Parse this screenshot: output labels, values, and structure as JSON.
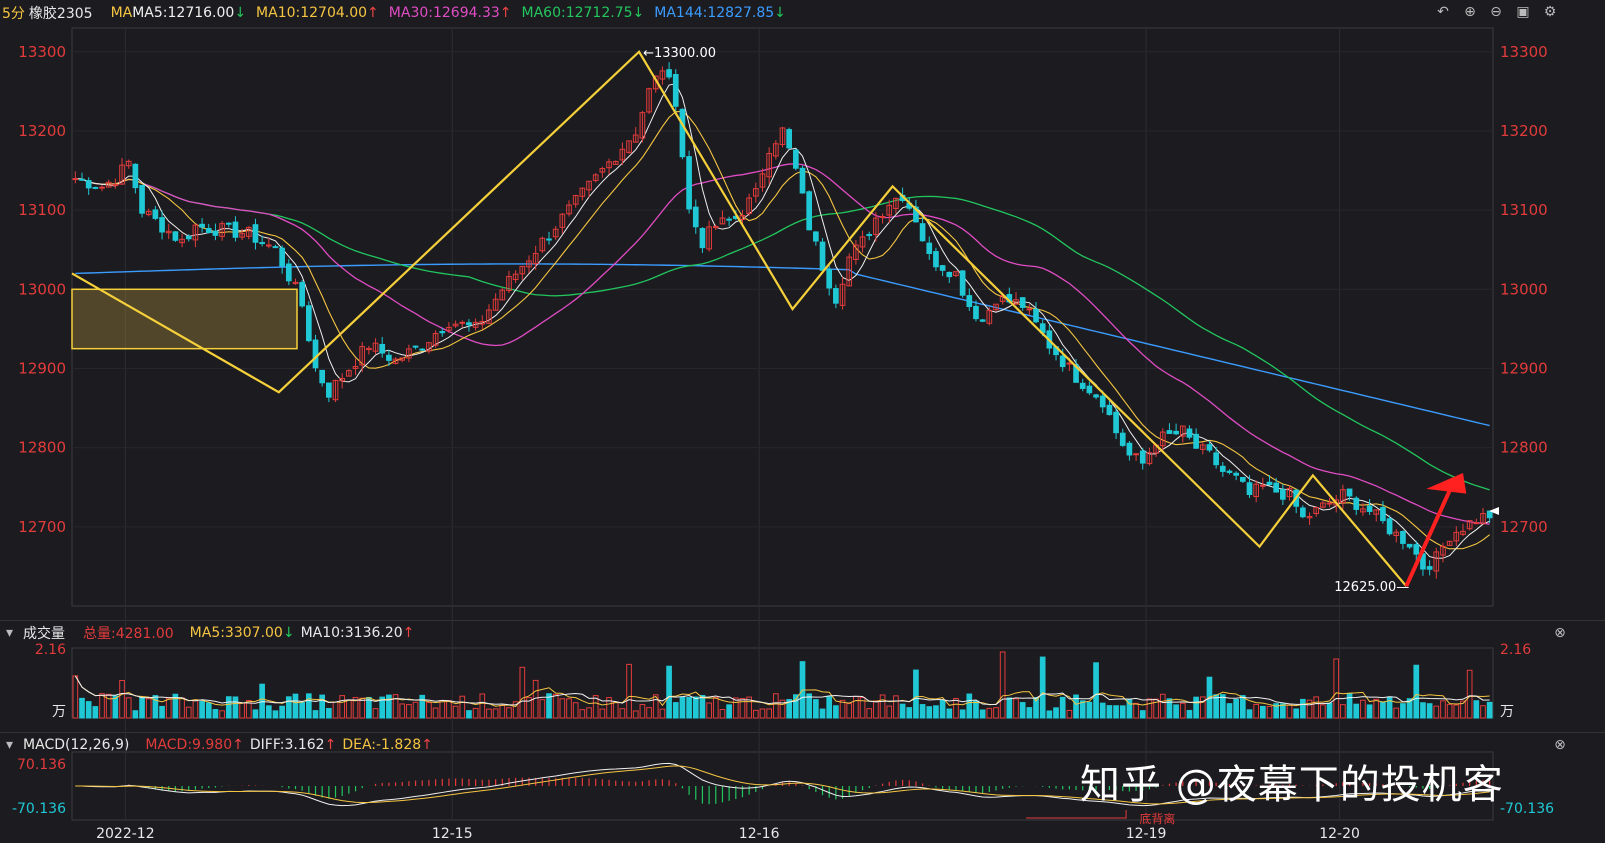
{
  "header": {
    "period": "5分",
    "symbol": "橡胶2305",
    "ma_label": "MA",
    "ma_items": [
      {
        "text": "MA5:12716.00",
        "arrow": "↓",
        "color": "#f0f0f0",
        "arrow_color": "#22c55e"
      },
      {
        "text": "MA10:12704.00",
        "arrow": "↑",
        "color": "#f5c542",
        "arrow_color": "#ef4444"
      },
      {
        "text": "MA30:12694.33",
        "arrow": "↑",
        "color": "#e04cc4",
        "arrow_color": "#ef4444"
      },
      {
        "text": "MA60:12712.75",
        "arrow": "↓",
        "color": "#22c55e",
        "arrow_color": "#22c55e"
      },
      {
        "text": "MA144:12827.85",
        "arrow": "↓",
        "color": "#3b9cff",
        "arrow_color": "#22c55e"
      }
    ]
  },
  "volume_header": {
    "title": "成交量",
    "total": "总量:4281.00",
    "ma5": "MA5:3307.00",
    "ma5_arrow": "↓",
    "ma10": "MA10:3136.20",
    "ma10_arrow": "↑"
  },
  "macd_header": {
    "title": "MACD(12,26,9)",
    "macd": "MACD:9.980",
    "macd_arrow": "↑",
    "diff": "DIFF:3.162",
    "diff_arrow": "↑",
    "dea": "DEA:-1.828",
    "dea_arrow": "↑"
  },
  "watermark": "知乎 @夜幕下的投机客",
  "colors": {
    "up": "#e23b3b",
    "down": "#1fc8d4",
    "zigzag": "#f5d03a",
    "background": "#1c1c20",
    "arrow": "#ff2020"
  },
  "chart_data": {
    "type": "candlestick",
    "x_ticks": [
      "2022-12",
      "12-15",
      "12-16",
      "12-19",
      "12-20"
    ],
    "price_ticks": [
      13300,
      13200,
      13100,
      13000,
      12900,
      12800,
      12700
    ],
    "ylim": [
      12600,
      13330
    ],
    "price_path": [
      [
        0,
        13140
      ],
      [
        2,
        13135
      ],
      [
        4,
        13130
      ],
      [
        6,
        13140
      ],
      [
        8,
        13160
      ],
      [
        10,
        13100
      ],
      [
        13,
        13080
      ],
      [
        16,
        13060
      ],
      [
        18,
        13080
      ],
      [
        22,
        13075
      ],
      [
        26,
        13070
      ],
      [
        30,
        13050
      ],
      [
        33,
        13000
      ],
      [
        34,
        12980
      ],
      [
        36,
        12900
      ],
      [
        38,
        12870
      ],
      [
        40,
        12890
      ],
      [
        44,
        12930
      ],
      [
        48,
        12910
      ],
      [
        52,
        12930
      ],
      [
        56,
        12960
      ],
      [
        60,
        12950
      ],
      [
        64,
        13000
      ],
      [
        68,
        13040
      ],
      [
        72,
        13080
      ],
      [
        76,
        13120
      ],
      [
        80,
        13160
      ],
      [
        84,
        13200
      ],
      [
        86,
        13250
      ],
      [
        88,
        13280
      ],
      [
        90,
        13240
      ],
      [
        92,
        13100
      ],
      [
        94,
        13060
      ],
      [
        96,
        13080
      ],
      [
        99,
        13090
      ],
      [
        102,
        13120
      ],
      [
        104,
        13180
      ],
      [
        106,
        13200
      ],
      [
        108,
        13150
      ],
      [
        110,
        13080
      ],
      [
        112,
        13030
      ],
      [
        114,
        12990
      ],
      [
        116,
        13040
      ],
      [
        118,
        13060
      ],
      [
        120,
        13090
      ],
      [
        122,
        13110
      ],
      [
        124,
        13120
      ],
      [
        126,
        13090
      ],
      [
        128,
        13040
      ],
      [
        130,
        13030
      ],
      [
        132,
        13020
      ],
      [
        134,
        12980
      ],
      [
        136,
        12960
      ],
      [
        138,
        12990
      ],
      [
        142,
        12980
      ],
      [
        146,
        12930
      ],
      [
        150,
        12890
      ],
      [
        154,
        12860
      ],
      [
        156,
        12820
      ],
      [
        158,
        12790
      ],
      [
        160,
        12780
      ],
      [
        162,
        12810
      ],
      [
        166,
        12820
      ],
      [
        168,
        12800
      ],
      [
        170,
        12790
      ],
      [
        172,
        12770
      ],
      [
        174,
        12760
      ],
      [
        176,
        12740
      ],
      [
        178,
        12750
      ],
      [
        182,
        12740
      ],
      [
        184,
        12710
      ],
      [
        186,
        12720
      ],
      [
        188,
        12730
      ],
      [
        190,
        12740
      ],
      [
        192,
        12730
      ],
      [
        194,
        12720
      ],
      [
        196,
        12705
      ],
      [
        198,
        12690
      ],
      [
        200,
        12680
      ],
      [
        202,
        12650
      ],
      [
        204,
        12660
      ],
      [
        206,
        12690
      ],
      [
        208,
        12700
      ],
      [
        210,
        12710
      ],
      [
        212,
        12715
      ]
    ],
    "zigzag_points": [
      [
        "2022-12",
        13020
      ],
      [
        "12-15",
        12870
      ],
      [
        "12-16",
        13300
      ],
      [
        "12-16",
        12975
      ],
      [
        "12-19",
        13130
      ],
      [
        "12-20",
        12675
      ],
      [
        "12-20",
        12765
      ],
      [
        "12-20",
        12625
      ]
    ],
    "annotations": [
      {
        "text": "13300.00",
        "value": 13300
      },
      {
        "text": "12625.00",
        "value": 12625
      }
    ],
    "ma_series": [
      {
        "name": "MA144",
        "start": 13020,
        "end": 12827.85,
        "color": "#3b9cff"
      },
      {
        "name": "MA60",
        "start": 13145,
        "end": 12712.75,
        "color": "#22c55e"
      },
      {
        "name": "MA30",
        "start": 13140,
        "end": 12694.33,
        "color": "#e04cc4"
      }
    ],
    "zone": {
      "top": 13000,
      "bottom": 12925
    },
    "volume_ticks": [
      "2.16",
      "万"
    ],
    "macd_ticks": [
      "70.136",
      "-70.136"
    ],
    "macd_annotation": "底背离"
  }
}
